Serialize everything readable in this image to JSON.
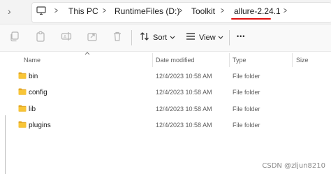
{
  "address_bar": {
    "breadcrumbs": [
      "This PC",
      "RuntimeFiles (D:)",
      "Toolkit",
      "allure-2.24.1"
    ],
    "overflow_arrow": ">"
  },
  "toolbar": {
    "sort_label": "Sort",
    "view_label": "View",
    "more_label": "•••",
    "icons": [
      "copy-icon",
      "paste-icon",
      "rename-icon",
      "share-icon",
      "delete-icon"
    ]
  },
  "columns": [
    "Name",
    "Date modified",
    "Type",
    "Size"
  ],
  "files": [
    {
      "name": "bin",
      "date": "12/4/2023 10:58 AM",
      "type": "File folder"
    },
    {
      "name": "config",
      "date": "12/4/2023 10:58 AM",
      "type": "File folder"
    },
    {
      "name": "lib",
      "date": "12/4/2023 10:58 AM",
      "type": "File folder"
    },
    {
      "name": "plugins",
      "date": "12/4/2023 10:58 AM",
      "type": "File folder"
    }
  ],
  "watermark": "CSDN @zljun8210",
  "colors": {
    "folder": "#f8c537",
    "folder_dark": "#e4a823",
    "highlight_mark": "#e01010"
  }
}
